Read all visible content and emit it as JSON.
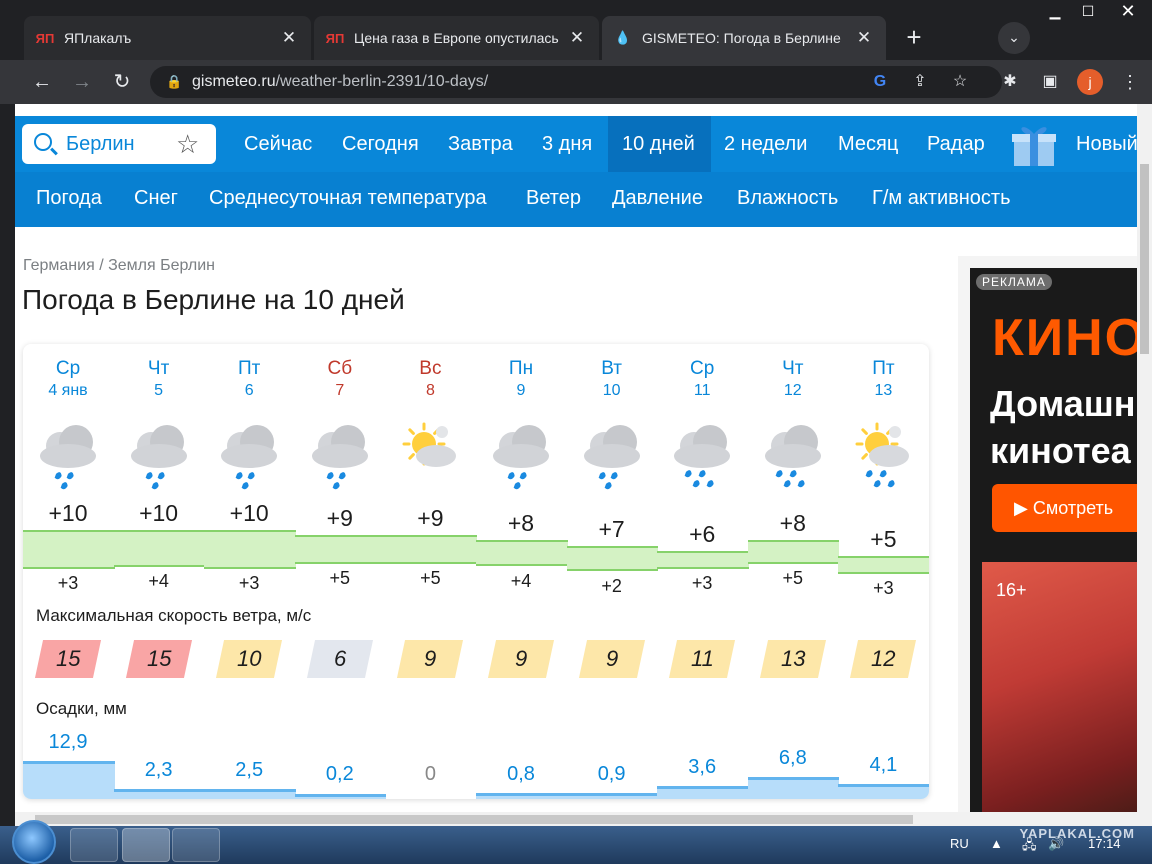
{
  "tabs": [
    {
      "title": "ЯПлакалъ",
      "favicon": "ЯП"
    },
    {
      "title": "Цена газа в Европе опустилась",
      "favicon": "ЯП"
    },
    {
      "title": "GISMETEO: Погода в Берлине",
      "favicon": "drop-icon"
    }
  ],
  "url": {
    "host": "gismeteo.ru",
    "path": "/weather-berlin-2391/10-days/"
  },
  "profile_initial": "j",
  "search": {
    "city": "Берлин"
  },
  "nav_main": [
    "Сейчас",
    "Сегодня",
    "Завтра",
    "3 дня",
    "10 дней",
    "2 недели",
    "Месяц",
    "Радар",
    "Новый"
  ],
  "nav_main_selected": "10 дней",
  "nav_sub": [
    "Погода",
    "Снег",
    "Среднесуточная температура",
    "Ветер",
    "Давление",
    "Влажность",
    "Г/м активность"
  ],
  "breadcrumb": {
    "country": "Германия",
    "sep": "/",
    "region": "Земля Берлин"
  },
  "page_title": "Погода в Берлине на 10 дней",
  "days": [
    {
      "dow": "Ср",
      "date": "4 янв",
      "weekend": false,
      "icon": "cloud-rain-icon",
      "tmax": "+10",
      "tmin": "+3",
      "wind": "15",
      "wind_level": "high",
      "precip": "12,9",
      "precip_mm": 12.9
    },
    {
      "dow": "Чт",
      "date": "5",
      "weekend": false,
      "icon": "cloud-rain-icon",
      "tmax": "+10",
      "tmin": "+4",
      "wind": "15",
      "wind_level": "high",
      "precip": "2,3",
      "precip_mm": 2.3
    },
    {
      "dow": "Пт",
      "date": "6",
      "weekend": false,
      "icon": "cloud-rain-icon",
      "tmax": "+10",
      "tmin": "+3",
      "wind": "10",
      "wind_level": "mid",
      "precip": "2,5",
      "precip_mm": 2.5
    },
    {
      "dow": "Сб",
      "date": "7",
      "weekend": true,
      "icon": "cloud-rain-icon",
      "tmax": "+9",
      "tmin": "+5",
      "wind": "6",
      "wind_level": "low",
      "precip": "0,2",
      "precip_mm": 0.2
    },
    {
      "dow": "Вс",
      "date": "8",
      "weekend": true,
      "icon": "sun-cloud-icon",
      "tmax": "+9",
      "tmin": "+5",
      "wind": "9",
      "wind_level": "mid",
      "precip": "0",
      "precip_mm": 0
    },
    {
      "dow": "Пн",
      "date": "9",
      "weekend": false,
      "icon": "cloud-rain-icon",
      "tmax": "+8",
      "tmin": "+4",
      "wind": "9",
      "wind_level": "mid",
      "precip": "0,8",
      "precip_mm": 0.8
    },
    {
      "dow": "Вт",
      "date": "10",
      "weekend": false,
      "icon": "cloud-rain-icon",
      "tmax": "+7",
      "tmin": "+2",
      "wind": "9",
      "wind_level": "mid",
      "precip": "0,9",
      "precip_mm": 0.9
    },
    {
      "dow": "Ср",
      "date": "11",
      "weekend": false,
      "icon": "cloud-heavy-rain-icon",
      "tmax": "+6",
      "tmin": "+3",
      "wind": "11",
      "wind_level": "mid",
      "precip": "3,6",
      "precip_mm": 3.6
    },
    {
      "dow": "Чт",
      "date": "12",
      "weekend": false,
      "icon": "cloud-heavy-rain-icon",
      "tmax": "+8",
      "tmin": "+5",
      "wind": "13",
      "wind_level": "mid",
      "precip": "6,8",
      "precip_mm": 6.8
    },
    {
      "dow": "Пт",
      "date": "13",
      "weekend": false,
      "icon": "sun-cloud-rain-icon",
      "tmax": "+5",
      "tmin": "+3",
      "wind": "12",
      "wind_level": "mid",
      "precip": "4,1",
      "precip_mm": 4.1
    }
  ],
  "wind_label": "Максимальная скорость ветра, м/с",
  "precip_label": "Осадки, мм",
  "colors": {
    "brand": "#0987d9",
    "wind_high": "#f9a5a5",
    "wind_mid": "#fde7a9",
    "wind_low": "#e3e7ee",
    "temp_band": "#d4f2c4",
    "precip_bar": "#b7ddfa"
  },
  "ad": {
    "label": "РЕКЛАМА",
    "brand": "КИНО",
    "line1": "Домашн",
    "line2": "кинотеа",
    "button": "Смотреть",
    "age": "16+"
  },
  "taskbar": {
    "lang": "RU",
    "time": "17:14",
    "watermark": "YAPLAKAL.COM"
  }
}
